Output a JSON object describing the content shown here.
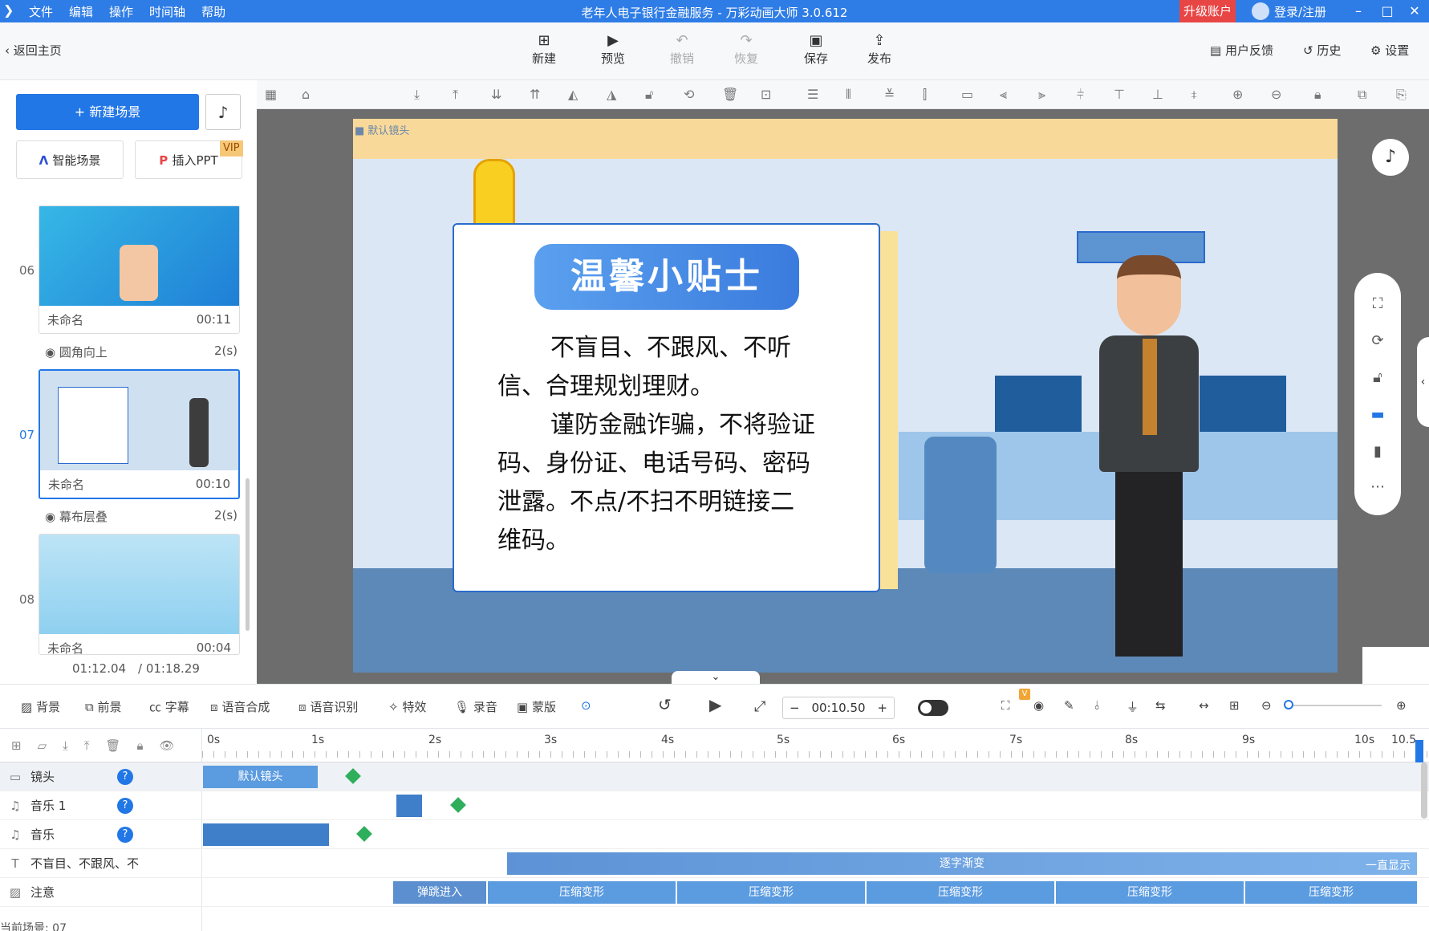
{
  "titlebar": {
    "menu": [
      "文件",
      "编辑",
      "操作",
      "时间轴",
      "帮助"
    ],
    "title": "老年人电子银行金融服务 - 万彩动画大师 3.0.612",
    "upgrade": "升级账户",
    "login": "登录/注册"
  },
  "toolbar": {
    "back": "返回主页",
    "buttons": [
      {
        "label": "新建",
        "icon": "plus-box-icon"
      },
      {
        "label": "预览",
        "icon": "play-icon"
      },
      {
        "label": "撤销",
        "icon": "undo-icon"
      },
      {
        "label": "恢复",
        "icon": "redo-icon"
      },
      {
        "label": "保存",
        "icon": "save-icon"
      },
      {
        "label": "发布",
        "icon": "publish-icon"
      }
    ],
    "right": [
      "用户反馈",
      "历史",
      "设置"
    ]
  },
  "left": {
    "new_scene": "+ 新建场景",
    "ai_scene": "智能场景",
    "insert_ppt": "插入PPT",
    "vip": "VIP",
    "scenes": [
      {
        "num": "06",
        "name": "未命名",
        "time": "00:11",
        "trans": "圆角向上",
        "trans_time": "2(s)"
      },
      {
        "num": "07",
        "name": "未命名",
        "time": "00:10",
        "trans": "幕布层叠",
        "trans_time": "2(s)",
        "selected": true
      },
      {
        "num": "08",
        "name": "未命名",
        "time": "00:04"
      }
    ],
    "current_time": "01:12.04",
    "total_time": "/ 01:18.29"
  },
  "stage": {
    "camera_label": "默认镜头",
    "tip_title": "温馨小贴士",
    "tip_text": [
      "不盲目、不跟风、不听",
      "信、合理规划理财。",
      "谨防金融诈骗，不将验证",
      "码、身份证、电话号码、密码",
      "泄露。不点/不扫不明链接二",
      "维码。"
    ]
  },
  "controls": {
    "left": [
      "背景",
      "前景",
      "字幕",
      "语音合成",
      "语音识别",
      "特效",
      "录音",
      "蒙版"
    ],
    "timecode": "00:10.50"
  },
  "timeline": {
    "ticks": [
      "0s",
      "1s",
      "2s",
      "3s",
      "4s",
      "5s",
      "6s",
      "7s",
      "8s",
      "9s",
      "10s",
      "10.5"
    ],
    "tracks": [
      {
        "name": "镜头",
        "icon": "camera-icon"
      },
      {
        "name": "音乐 1",
        "icon": "music-note-icon"
      },
      {
        "name": "音乐",
        "icon": "music-note-icon"
      },
      {
        "name": "不盲目、不跟风、不",
        "icon": "text-icon"
      },
      {
        "name": "注意",
        "icon": "image-icon"
      }
    ],
    "clips": {
      "camera": "默认镜头",
      "text_effect": "逐字渐变",
      "text_end": "一直显示",
      "img_in": "弹跳进入",
      "img_loop": "压缩变形"
    }
  },
  "status": "当前场景: 07"
}
